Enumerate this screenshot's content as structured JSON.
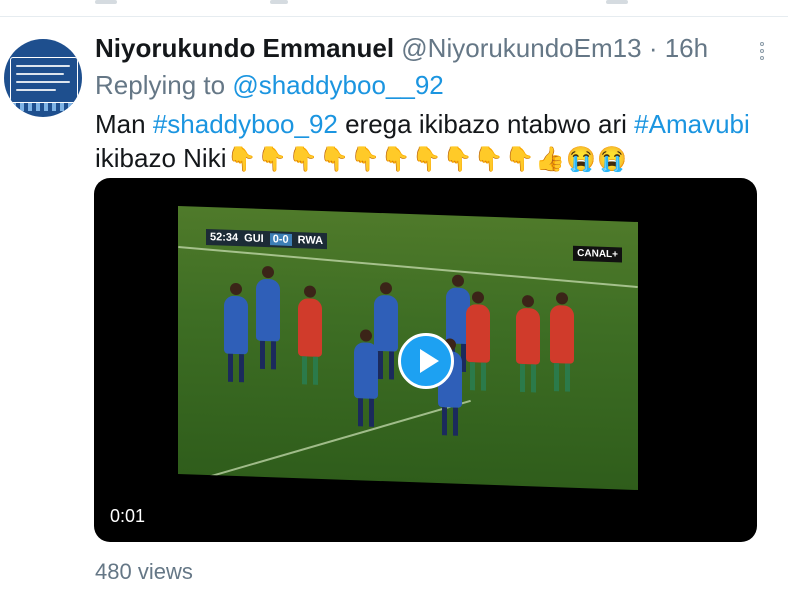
{
  "tweet": {
    "author_name": "Niyorukundo Emmanuel",
    "author_handle": "@NiyorukundoEm13",
    "separator": "·",
    "time": "16h",
    "reply_prefix": "Replying to",
    "reply_mention": "@shaddyboo__92",
    "text_parts": {
      "p1": "Man ",
      "tag1": "#shaddyboo_92",
      "p2": " erega ikibazo ntabwo ari ",
      "tag2": "#Amavubi",
      "p3": " ikibazo Niki",
      "emojis": "👇👇👇👇👇👇👇👇👇👇👍😭😭"
    },
    "avatar_icon": "avatar-logo-icon",
    "more_icon": "more-options-icon"
  },
  "video": {
    "duration": "0:01",
    "scoreboard": {
      "time": "52:34",
      "home": "GUI",
      "score": "0-0",
      "away": "RWA"
    },
    "broadcaster": "CANAL+",
    "play_icon": "play-icon",
    "accent_color": "#1da1f2"
  },
  "stats": {
    "views": "480 views"
  }
}
